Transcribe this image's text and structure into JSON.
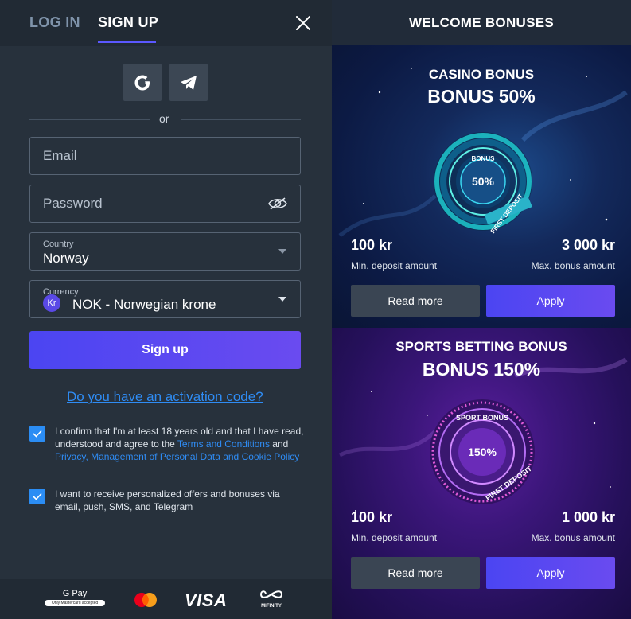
{
  "auth_tabs": {
    "login": "LOG IN",
    "signup": "SIGN UP"
  },
  "divider": "or",
  "form": {
    "email_placeholder": "Email",
    "password_placeholder": "Password",
    "country_label": "Country",
    "country_value": "Norway",
    "currency_label": "Currency",
    "currency_badge": "Kr",
    "currency_value": "NOK - Norwegian krone",
    "signup_button": "Sign up",
    "activation_link": "Do you have an activation code?"
  },
  "consents": {
    "age_text": "I confirm that I'm at least 18 years old and that I have read, understood and agree to the ",
    "terms_link": "Terms and Conditions",
    "and": " and ",
    "privacy_link": "Privacy, Management of Personal Data and Cookie Policy",
    "offers_text": "I want to receive personalized offers and bonuses via email, push, SMS, and Telegram"
  },
  "payments": {
    "gpay_label": "G Pay",
    "gpay_note": "Only Mastercard accepted",
    "visa": "VISA",
    "mifinity": "MIFINITY"
  },
  "bonuses": {
    "title": "WELCOME BONUSES",
    "casino": {
      "subtitle": "CASINO BONUS",
      "headline": "BONUS 50%",
      "wheel_top": "BONUS",
      "wheel_pct": "50%",
      "wheel_ribbon": "FIRST DEPOSIT",
      "min_amount": "100 kr",
      "min_caption": "Min. deposit amount",
      "max_amount": "3 000 kr",
      "max_caption": "Max. bonus amount",
      "read_more": "Read more",
      "apply": "Apply"
    },
    "sports": {
      "subtitle": "SPORTS BETTING BONUS",
      "headline": "BONUS 150%",
      "wheel_top": "SPORT BONUS",
      "wheel_pct": "150%",
      "wheel_ribbon": "FIRST DEPOSIT",
      "min_amount": "100 kr",
      "min_caption": "Min. deposit amount",
      "max_amount": "1 000 kr",
      "max_caption": "Max. bonus amount",
      "read_more": "Read more",
      "apply": "Apply"
    }
  },
  "colors": {
    "accent": "#5b58ff",
    "link": "#2f8cf4",
    "panel": "#27313c",
    "checkbox": "#2b8df4"
  }
}
